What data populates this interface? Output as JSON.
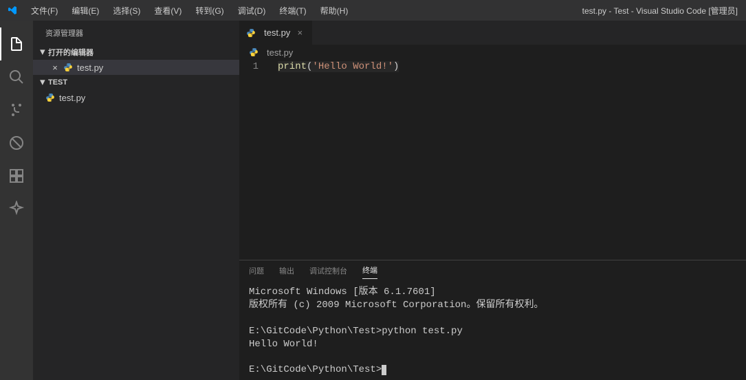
{
  "titlebar": {
    "title": "test.py - Test - Visual Studio Code [管理员]"
  },
  "menu": {
    "file": "文件(F)",
    "edit": "编辑(E)",
    "selection": "选择(S)",
    "view": "查看(V)",
    "go": "转到(G)",
    "debug": "调试(D)",
    "terminal": "终端(T)",
    "help": "帮助(H)"
  },
  "sidebar": {
    "title": "资源管理器",
    "open_editors_label": "打开的编辑器",
    "open_editor_file": "test.py",
    "workspace_name": "TEST",
    "workspace_file": "test.py"
  },
  "tab": {
    "label": "test.py"
  },
  "breadcrumb": {
    "file": "test.py"
  },
  "editor": {
    "line_number": "1",
    "code_fn": "print",
    "code_open": "(",
    "code_str": "'Hello World!'",
    "code_close": ")"
  },
  "panel": {
    "problems": "问题",
    "output": "输出",
    "debug_console": "调试控制台",
    "terminal": "终端"
  },
  "terminal": {
    "line1": "Microsoft Windows [版本 6.1.7601]",
    "line2": "版权所有 (c) 2009 Microsoft Corporation。保留所有权利。",
    "blank1": "",
    "line3": "E:\\GitCode\\Python\\Test>python test.py",
    "line4": "Hello World!",
    "blank2": "",
    "prompt": "E:\\GitCode\\Python\\Test>"
  }
}
